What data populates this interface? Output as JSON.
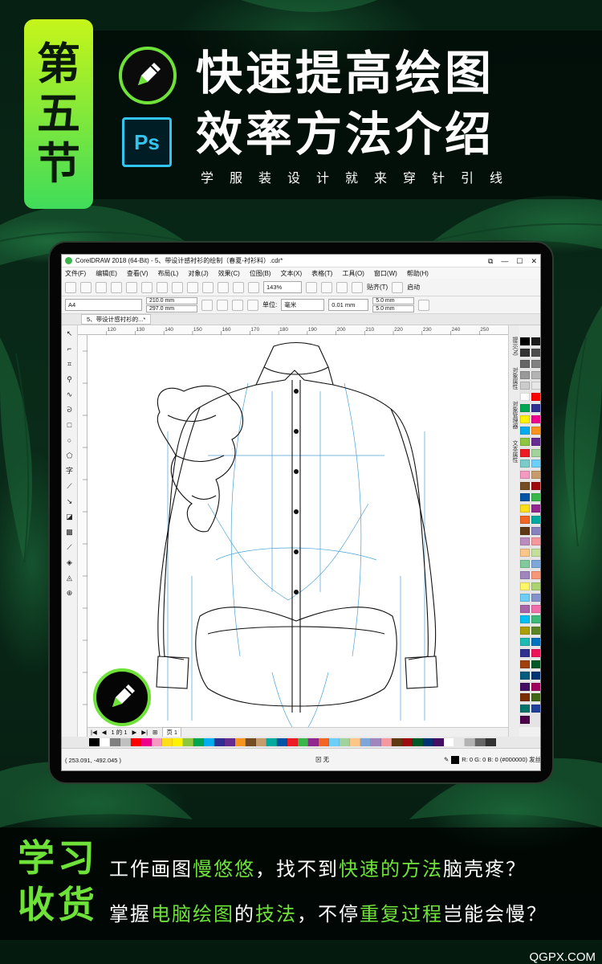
{
  "header": {
    "badge_chars": [
      "第",
      "五",
      "节"
    ],
    "title_line1": "快速提高绘图",
    "title_line2": "效率方法介绍",
    "subtitle": "学服装设计就来穿针引线",
    "ps_logo_text": "Ps"
  },
  "app": {
    "window_title": "CorelDRAW 2018 (64-Bit) - 5、带设计感衬衫的绘制（春夏-衬衫料）.cdr*",
    "window_controls": [
      "⧉",
      "—",
      "☐",
      "✕"
    ],
    "menu": [
      "文件(F)",
      "编辑(E)",
      "查看(V)",
      "布局(L)",
      "对象(J)",
      "效果(C)",
      "位图(B)",
      "文本(X)",
      "表格(T)",
      "工具(O)",
      "窗口(W)",
      "帮助(H)"
    ],
    "toolbar1": {
      "zoom": "143%",
      "snap_label": "贴齐(T)",
      "launch_label": "启动"
    },
    "toolbar2": {
      "page_size": "A4",
      "width": "210.0 mm",
      "height": "297.0 mm",
      "unit_label": "单位:",
      "unit_value": "毫米",
      "nudge": "0.01 mm",
      "dup_x": "5.0 mm",
      "dup_y": "5.0 mm"
    },
    "doc_tab": "5、带设计感衬衫的...*",
    "ruler_ticks": [
      "120",
      "130",
      "140",
      "150",
      "160",
      "170",
      "180",
      "190",
      "200",
      "210",
      "220",
      "230",
      "240",
      "250"
    ],
    "dockers": [
      "提示(N)",
      "对象属性",
      "对象管理器",
      "文本属性"
    ],
    "page_nav": {
      "page_of": "1 的 1",
      "page_tab": "页 1"
    },
    "status": {
      "coords": "( 253.091, -492.045 )",
      "fill_label": "无",
      "outline_label": "R: 0 G: 0 B: 0 (#000000) 发丝"
    },
    "palette_colors": [
      "#000000",
      "#1a1a1a",
      "#333333",
      "#4d4d4d",
      "#666666",
      "#808080",
      "#999999",
      "#b3b3b3",
      "#cccccc",
      "#e6e6e6",
      "#ffffff",
      "#ff0000",
      "#00a651",
      "#2e3192",
      "#fff200",
      "#ec008c",
      "#00aeef",
      "#f7941d",
      "#8dc63f",
      "#662d91",
      "#ed1c24",
      "#a3d39c",
      "#7accc8",
      "#6dcff6",
      "#f49ac1",
      "#c69c6d",
      "#754c24",
      "#9e0b0f",
      "#0054a6",
      "#39b54a",
      "#ffde17",
      "#92278f",
      "#f26522",
      "#00a99d",
      "#603913",
      "#8781bd",
      "#bd8cbf",
      "#f5989d",
      "#fdc689",
      "#c4df9b",
      "#82ca9c",
      "#7da7d9",
      "#a186be",
      "#f7977a",
      "#fff568",
      "#acd373",
      "#6ecff6",
      "#8393ca",
      "#a864a8",
      "#f06eaa",
      "#00bff3",
      "#3cb878",
      "#aba000",
      "#598527",
      "#1cbbb4",
      "#0072bc",
      "#2e3192",
      "#ee145b",
      "#a0410d",
      "#005826",
      "#005b7f",
      "#003471",
      "#440e62",
      "#9e005d",
      "#7b2e00",
      "#406618",
      "#00746b",
      "#21409a",
      "#4b0049"
    ],
    "h_palette_colors": [
      "#000000",
      "#ffffff",
      "#808080",
      "#c0c0c0",
      "#ff0000",
      "#ec008c",
      "#f49ac1",
      "#ffde17",
      "#fff200",
      "#8dc63f",
      "#00a651",
      "#00aeef",
      "#2e3192",
      "#662d91",
      "#f7941d",
      "#754c24",
      "#c69c6d",
      "#00a99d",
      "#0054a6",
      "#ed1c24",
      "#39b54a",
      "#92278f",
      "#f26522",
      "#6dcff6",
      "#a3d39c",
      "#fdc689",
      "#7da7d9",
      "#a186be",
      "#f5989d",
      "#603913",
      "#9e0b0f",
      "#005826",
      "#003471",
      "#440e62",
      "#ffffff",
      "#e6e6e6",
      "#b3b3b3",
      "#666666",
      "#333333"
    ]
  },
  "bottom": {
    "learn_label1": "学习",
    "learn_label2": "收货",
    "line1": [
      {
        "text": "工作画图",
        "hl": false
      },
      {
        "text": "慢悠悠",
        "hl": true
      },
      {
        "text": "，找不到",
        "hl": false
      },
      {
        "text": "快速的方法",
        "hl": true
      },
      {
        "text": "脑壳疼？",
        "hl": false
      }
    ],
    "line2": [
      {
        "text": "掌握",
        "hl": false
      },
      {
        "text": "电脑绘图",
        "hl": true
      },
      {
        "text": "的",
        "hl": false
      },
      {
        "text": "技法",
        "hl": true
      },
      {
        "text": "，不停",
        "hl": false
      },
      {
        "text": "重复过程",
        "hl": true
      },
      {
        "text": "岂能会慢？",
        "hl": false
      }
    ]
  },
  "watermark": "QGPX.COM",
  "colors": {
    "accent_green": "#6fe23a",
    "badge_top": "#c6f51a",
    "badge_bottom": "#3fdc5a",
    "ps_blue": "#31c5f0"
  }
}
